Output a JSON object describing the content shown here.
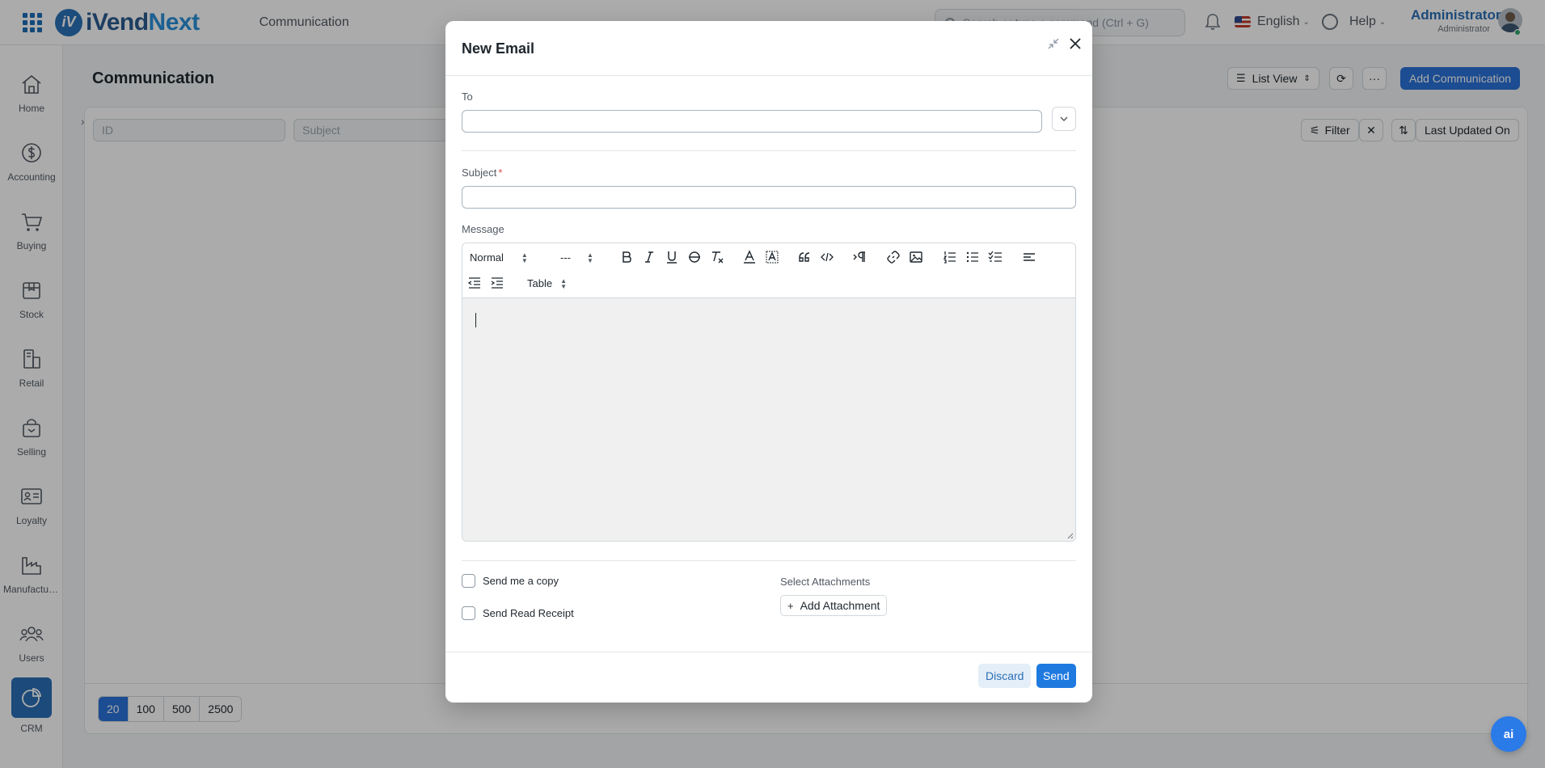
{
  "navbar": {
    "brand_part1": "iVend",
    "brand_part2": "Next",
    "brand_mark": "iV",
    "breadcrumb": "Communication",
    "search_placeholder": "Search or type a command (Ctrl + G)",
    "language": "English",
    "help": "Help",
    "user_name": "Administrator",
    "user_role": "Administrator"
  },
  "sidebar": {
    "items": [
      {
        "label": "Home",
        "icon": "home-icon"
      },
      {
        "label": "Accounting",
        "icon": "dollar-icon"
      },
      {
        "label": "Buying",
        "icon": "cart-icon"
      },
      {
        "label": "Stock",
        "icon": "box-icon"
      },
      {
        "label": "Retail",
        "icon": "pos-icon"
      },
      {
        "label": "Selling",
        "icon": "bag-icon"
      },
      {
        "label": "Loyalty",
        "icon": "id-card-icon"
      },
      {
        "label": "Manufacturing",
        "icon": "factory-icon"
      },
      {
        "label": "Users",
        "icon": "users-icon"
      },
      {
        "label": "CRM",
        "icon": "chart-icon"
      }
    ]
  },
  "page": {
    "title": "Communication",
    "list_view": "List View",
    "add_button": "Add Communication",
    "filter_id_placeholder": "ID",
    "filter_subject_placeholder": "Subject",
    "filter_label": "Filter",
    "sort_label": "Last Updated On",
    "page_sizes": [
      "20",
      "100",
      "500",
      "2500"
    ]
  },
  "modal": {
    "title": "New Email",
    "to_label": "To",
    "to_value": "",
    "subject_label": "Subject",
    "subject_required_mark": "*",
    "subject_value": "",
    "message_label": "Message",
    "toolbar": {
      "header_select": "Normal",
      "size_select": "---",
      "table_select": "Table"
    },
    "send_copy_label": "Send me a copy",
    "read_receipt_label": "Send Read Receipt",
    "attachments_label": "Select Attachments",
    "add_attachment_label": "Add Attachment",
    "discard_label": "Discard",
    "send_label": "Send"
  },
  "ai_button_label": "ai",
  "colors": {
    "primary": "#2a72d8",
    "brand_dark": "#2a5c8f",
    "brand_light": "#2a8fd8"
  }
}
